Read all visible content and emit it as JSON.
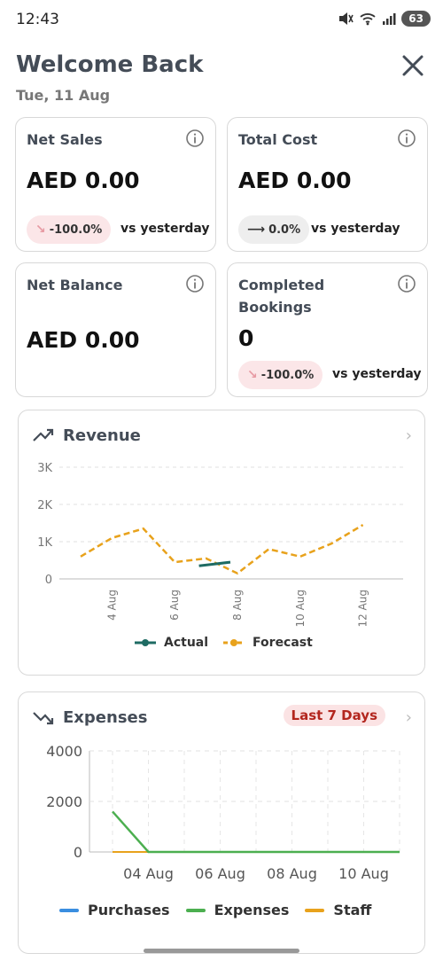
{
  "status_bar": {
    "time": "12:43",
    "battery": "63"
  },
  "header": {
    "title": "Welcome Back",
    "date": "Tue, 11 Aug"
  },
  "cards": [
    {
      "label": "Net Sales",
      "value": "AED 0.00",
      "change": "-100.0%",
      "change_arrow": "↘",
      "trend": "down",
      "compare": "vs yesterday"
    },
    {
      "label": "Total Cost",
      "value": "AED 0.00",
      "change": "0.0%",
      "change_arrow": "⟶",
      "trend": "flat",
      "compare": "vs yesterday"
    },
    {
      "label": "Net Balance",
      "value": "AED 0.00"
    },
    {
      "label": "Completed Bookings",
      "value": "0",
      "change": "-100.0%",
      "change_arrow": "↘",
      "trend": "down",
      "compare": "vs yesterday"
    }
  ],
  "revenue": {
    "title": "Revenue",
    "legend": [
      "Actual",
      "Forecast"
    ],
    "colors": {
      "actual": "#1e6b63",
      "forecast": "#e8a21c"
    }
  },
  "expenses": {
    "title": "Expenses",
    "period_badge": "Last 7 Days",
    "legend": [
      "Purchases",
      "Expenses",
      "Staff"
    ],
    "colors": {
      "purchases": "#3a8ee0",
      "expenses": "#4caf50",
      "staff": "#e8a21c"
    }
  },
  "chart_data": [
    {
      "type": "line",
      "title": "Revenue",
      "x": [
        "3 Aug",
        "4 Aug",
        "5 Aug",
        "6 Aug",
        "7 Aug",
        "8 Aug",
        "9 Aug",
        "10 Aug",
        "11 Aug",
        "12 Aug",
        "13 Aug"
      ],
      "x_tick_labels": [
        "4 Aug",
        "6 Aug",
        "8 Aug",
        "10 Aug",
        "12 Aug"
      ],
      "y_tick_labels": [
        "0",
        "1K",
        "2K",
        "3K"
      ],
      "ylim": [
        0,
        3000
      ],
      "grid": true,
      "legend_position": "bottom",
      "series": [
        {
          "name": "Actual",
          "x": [
            "7 Aug",
            "8 Aug"
          ],
          "values": [
            350,
            450
          ]
        },
        {
          "name": "Forecast",
          "x": [
            "3 Aug",
            "4 Aug",
            "5 Aug",
            "6 Aug",
            "7 Aug",
            "8 Aug",
            "9 Aug",
            "10 Aug",
            "11 Aug",
            "12 Aug",
            "13 Aug"
          ],
          "values": [
            600,
            1100,
            1350,
            450,
            550,
            150,
            800,
            600,
            950,
            1450,
            null
          ]
        }
      ]
    },
    {
      "type": "line",
      "title": "Expenses",
      "x": [
        "03 Aug",
        "04 Aug",
        "05 Aug",
        "06 Aug",
        "07 Aug",
        "08 Aug",
        "09 Aug",
        "10 Aug",
        "11 Aug"
      ],
      "x_tick_labels": [
        "04 Aug",
        "06 Aug",
        "08 Aug",
        "10 Aug"
      ],
      "y_tick_labels": [
        "0",
        "2000",
        "4000"
      ],
      "ylim": [
        0,
        4000
      ],
      "grid": true,
      "legend_position": "bottom",
      "series": [
        {
          "name": "Purchases",
          "values": [
            0,
            0,
            0,
            0,
            0,
            0,
            0,
            0,
            0
          ]
        },
        {
          "name": "Expenses",
          "values": [
            1600,
            0,
            0,
            0,
            0,
            0,
            0,
            0,
            0
          ]
        },
        {
          "name": "Staff",
          "values": [
            0,
            0,
            0,
            0,
            0,
            0,
            0,
            0,
            0
          ]
        }
      ]
    }
  ]
}
